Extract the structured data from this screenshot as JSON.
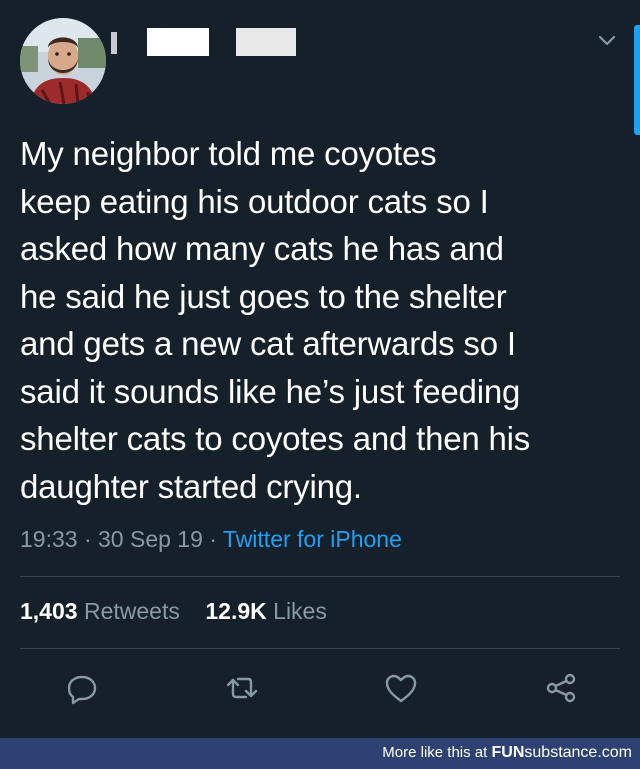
{
  "tweet": {
    "text": "My neighbor told me coyotes\nkeep eating his outdoor cats so I\nasked how many cats he has and\nhe said he just goes to the shelter\nand gets a new cat afterwards so I\nsaid it sounds like he’s just feeding\nshelter cats to coyotes and then his\ndaughter started crying.",
    "time": "19:33",
    "sep1": " · ",
    "date": "30 Sep 19",
    "sep2": " · ",
    "source": "Twitter for iPhone"
  },
  "stats": {
    "retweets_count": "1,403",
    "retweets_label": "Retweets",
    "likes_count": "12.9K",
    "likes_label": "Likes"
  },
  "icons": {
    "header": [
      "chevron-down-icon"
    ],
    "actions": [
      "reply-icon",
      "retweet-icon",
      "like-icon",
      "share-icon"
    ]
  },
  "colors": {
    "background": "#15202b",
    "text": "#ffffff",
    "secondary": "#8899a6",
    "accent": "#1da1f2",
    "divider": "#38444d",
    "footer": "#2d4272"
  },
  "footer": {
    "prefix": "More like this at ",
    "brand_bold": "FUN",
    "brand_rest": "substance.com"
  }
}
